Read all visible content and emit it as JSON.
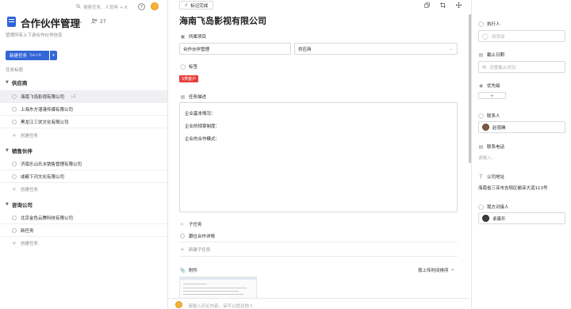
{
  "search": {
    "placeholder": "搜索任务、人员再 + K"
  },
  "header": {
    "help": "?",
    "member_count": "27"
  },
  "project": {
    "title": "合作伙伴管理",
    "description": "管理所有上下游合作伙伴信息"
  },
  "new_task": {
    "label": "新建任务",
    "hotkey": "Tab+N"
  },
  "list": {
    "column_header": "任务标题",
    "create_label": "创建任务",
    "groups": [
      {
        "name": "供应商",
        "tasks": [
          {
            "title": "海南飞岛影视有限公司",
            "sub_count": "1",
            "selected": true
          },
          {
            "title": "上海东方湛港传媒有限公司"
          },
          {
            "title": "黑龙江三伏文化有限公司"
          }
        ]
      },
      {
        "name": "销售伙伴",
        "tasks": [
          {
            "title": "济南乐山乐水销售管理有限公司"
          },
          {
            "title": "成都下河文化有限公司"
          }
        ]
      },
      {
        "name": "咨询公司",
        "tasks": [
          {
            "title": "北京金色云腾科技有限公司"
          },
          {
            "title": "新任务"
          }
        ]
      }
    ]
  },
  "detail": {
    "mark_done": "标记完成",
    "title": "海南飞岛影视有限公司",
    "project_label": "所属项目",
    "project_value": "合作伙伴管理",
    "section_value": "供应商",
    "tags_label": "标签",
    "tag": "S类客户",
    "desc_label": "任务描述",
    "desc_lines": [
      "企业基本情况：",
      "企业的规章制度：",
      "企业的合作模式："
    ],
    "subtasks_label": "子任务",
    "subtask": "跟往合作详情",
    "new_subtask": "新建子任务",
    "attachments_label": "附件",
    "sort_label": "按上传时间排序",
    "comment_placeholder": "请输入评论内容，审可以提及他人"
  },
  "side": {
    "assignee_label": "执行人",
    "assignee_placeholder": "待添加",
    "due_label": "截止日期",
    "due_placeholder": "设置截止时间",
    "priority_label": "优先级",
    "priority_add": "+",
    "contact_label": "联系人",
    "contact_name": "赵雨琳",
    "phone_label": "联系电话",
    "phone_placeholder": "请输入...",
    "address_label": "公司地址",
    "address_value": "海南省三亚市吉阳区榆亚大道113号",
    "partner_label": "我方对接人",
    "partner_name": "卓康乐"
  }
}
